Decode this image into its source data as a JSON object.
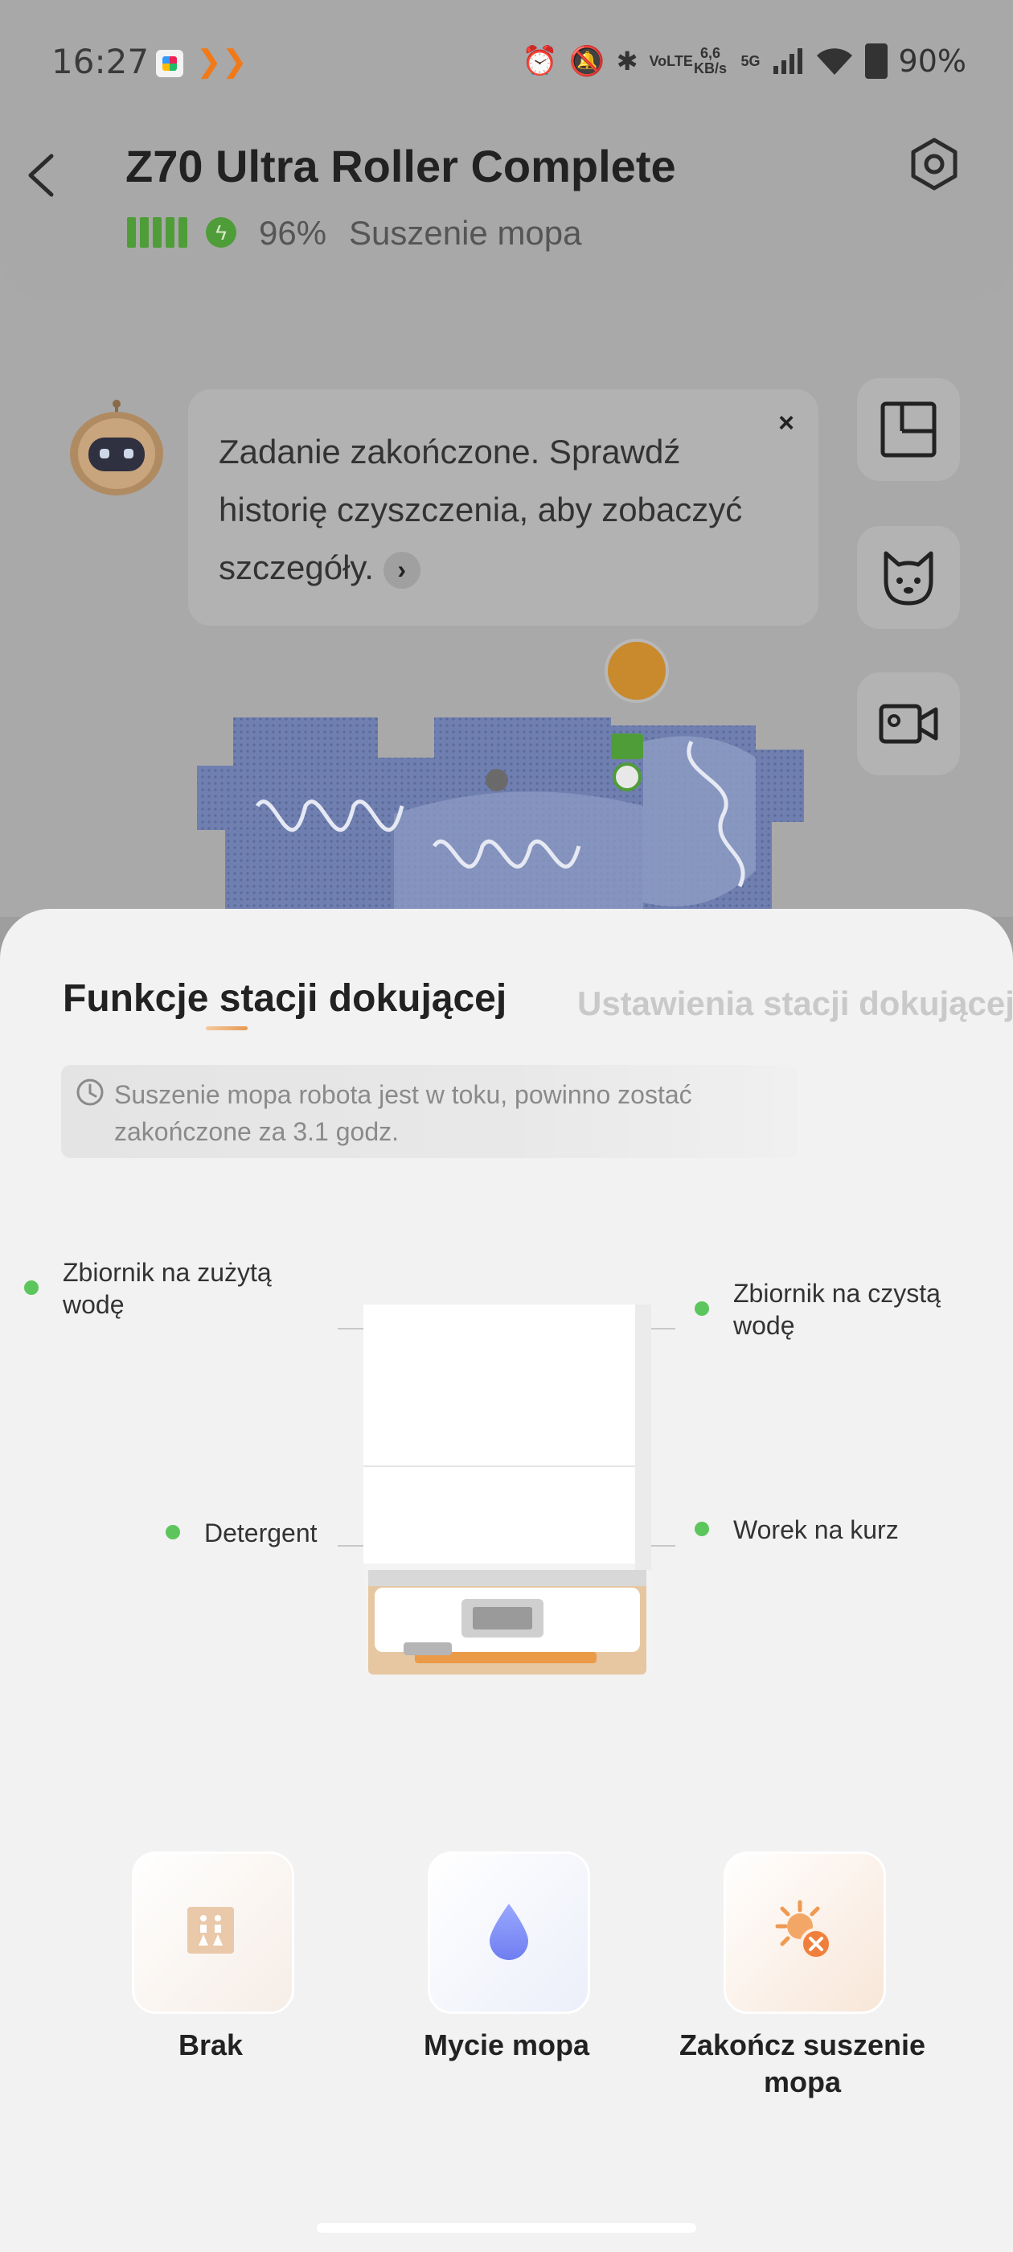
{
  "status_bar": {
    "time": "16:27",
    "volte": "VoLTE",
    "net_speed": "6,6 KB/s",
    "net_type": "5G",
    "battery": "90%"
  },
  "header": {
    "title": "Z70 Ultra Roller Complete",
    "battery_percent": "96%",
    "status": "Suszenie mopa"
  },
  "notification": {
    "text": "Zadanie zakończone. Sprawdź historię czyszczenia, aby zobaczyć szczegóły."
  },
  "sheet": {
    "tabs": [
      {
        "label": "Funkcje stacji dokującej",
        "active": true
      },
      {
        "label": "Ustawienia stacji dokującej",
        "active": false
      }
    ],
    "notice": "Suszenie mopa robota jest w toku, powinno zostać zakończone za 3.1 godz.",
    "station_labels": {
      "dirty_tank": "Zbiornik na zużytą wodę",
      "clean_tank": "Zbiornik na czystą wodę",
      "detergent": "Detergent",
      "dust_bag": "Worek na kurz"
    },
    "actions": [
      {
        "label": "Brak",
        "icon": "self-clean-icon"
      },
      {
        "label": "Mycie mopa",
        "icon": "water-drop-icon"
      },
      {
        "label": "Zakończ suszenie mopa",
        "icon": "stop-drying-icon"
      }
    ]
  },
  "colors": {
    "status_dot": "#5cc65c",
    "accent_orange": "#e69a52",
    "battery_green": "#4f9d39"
  }
}
